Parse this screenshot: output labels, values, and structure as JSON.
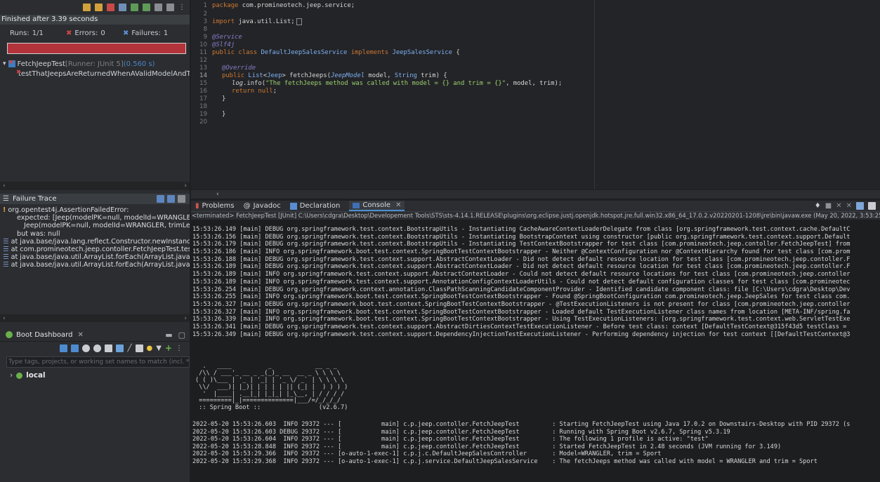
{
  "junit": {
    "status": "Finished after 3.39 seconds",
    "runs_label": "Runs: ",
    "runs_value": "1/1",
    "errors_label": "Errors: ",
    "errors_value": "0",
    "failures_label": "Failures: ",
    "failures_value": "1",
    "progress_color": "#b3333b",
    "tree": [
      {
        "label": "FetchJeepTest",
        "runner": " [Runner: JUnit 5]",
        "time": " (0.560 s)"
      },
      {
        "label": "testThatJeepsAreReturnedWhenAValidModelAndTrimA"
      }
    ]
  },
  "failure_trace": {
    "title": "Failure Trace",
    "lines": [
      "org.opentest4j.AssertionFailedError:",
      "expected: [Jeep(modelPK=null, modelId=WRANGLER, trimLe",
      "Jeep(modelPK=null, modelId=WRANGLER, trimLevel=spor",
      "but was: null",
      "at java.base/java.lang.reflect.Constructor.newInstanceWithC",
      "at com.promineotech.jeep.contoller.FetchJeepTest.testThatJ",
      "at java.base/java.util.ArrayList.forEach(ArrayList.java:1511)",
      "at java.base/java.util.ArrayList.forEach(ArrayList.java:1511)"
    ]
  },
  "boot_dashboard": {
    "tab_label": "Boot Dashboard",
    "filter_placeholder": "Type tags, projects, or working set names to match (incl. * and",
    "item": "local"
  },
  "editor": {
    "lines": [
      {
        "n": "1",
        "text": "package com.promineotech.jeep.service;"
      },
      {
        "n": "2",
        "text": ""
      },
      {
        "n": "3",
        "text": "import java.util.List;"
      },
      {
        "n": "8",
        "text": ""
      },
      {
        "n": "9",
        "text": "@Service"
      },
      {
        "n": "10",
        "text": "@Slf4j"
      },
      {
        "n": "11",
        "text": "public class DefaultJeepSalesService implements JeepSalesService {"
      },
      {
        "n": "12",
        "text": ""
      },
      {
        "n": "13",
        "text": "@Override"
      },
      {
        "n": "14",
        "text": "public List<Jeep> fetchJeeps(JeepModel model, String trim) {"
      },
      {
        "n": "15",
        "text": "log.info(\"The fetchJeeps method was called with model = {} and trim = {}\", model, trim);"
      },
      {
        "n": "16",
        "text": "return null;"
      },
      {
        "n": "17",
        "text": "}"
      },
      {
        "n": "18",
        "text": ""
      },
      {
        "n": "19",
        "text": "}"
      },
      {
        "n": "20",
        "text": ""
      }
    ]
  },
  "console": {
    "tabs": [
      "Problems",
      "Javadoc",
      "Declaration",
      "Console"
    ],
    "terminated": "<terminated> FetchJeepTest [JUnit] C:\\Users\\cdgra\\Desktop\\Developement Tools\\STS\\sts-4.14.1.RELEASE\\plugins\\org.eclipse.justj.openjdk.hotspot.jre.full.win32.x86_64_17.0.2.v20220201-1208\\jre\\bin\\javaw.exe  (May 20, 2022, 3:53:25 PM – 3:5",
    "log": [
      "15:53:26.149 [main] DEBUG org.springframework.test.context.BootstrapUtils - Instantiating CacheAwareContextLoaderDelegate from class [org.springframework.test.context.cache.DefaultC",
      "15:53:26.156 [main] DEBUG org.springframework.test.context.BootstrapUtils - Instantiating BootstrapContext using constructor [public org.springframework.test.context.support.Default",
      "15:53:26.179 [main] DEBUG org.springframework.test.context.BootstrapUtils - Instantiating TestContextBootstrapper for test class [com.promineotech.jeep.contoller.FetchJeepTest] from",
      "15:53:26.186 [main] INFO org.springframework.boot.test.context.SpringBootTestContextBootstrapper - Neither @ContextConfiguration nor @ContextHierarchy found for test class [com.prom",
      "15:53:26.188 [main] DEBUG org.springframework.test.context.support.AbstractContextLoader - Did not detect default resource location for test class [com.promineotech.jeep.contoller.F",
      "15:53:26.189 [main] DEBUG org.springframework.test.context.support.AbstractContextLoader - Did not detect default resource location for test class [com.promineotech.jeep.contoller.F",
      "15:53:26.189 [main] INFO org.springframework.test.context.support.AbstractContextLoader - Could not detect default resource locations for test class [com.promineotech.jeep.contoller",
      "15:53:26.189 [main] INFO org.springframework.test.context.support.AnnotationConfigContextLoaderUtils - Could not detect default configuration classes for test class [com.promineotec",
      "15:53:26.254 [main] DEBUG org.springframework.context.annotation.ClassPathScanningCandidateComponentProvider - Identified candidate component class: file [C:\\Users\\cdgra\\Desktop\\Dev",
      "15:53:26.255 [main] INFO org.springframework.boot.test.context.SpringBootTestContextBootstrapper - Found @SpringBootConfiguration com.promineotech.jeep.JeepSales for test class com.",
      "15:53:26.327 [main] DEBUG org.springframework.boot.test.context.SpringBootTestContextBootstrapper - @TestExecutionListeners is not present for class [com.promineotech.jeep.contoller",
      "15:53:26.327 [main] INFO org.springframework.boot.test.context.SpringBootTestContextBootstrapper - Loaded default TestExecutionListener class names from location [META-INF/spring.fa",
      "15:53:26.339 [main] INFO org.springframework.boot.test.context.SpringBootTestContextBootstrapper - Using TestExecutionListeners: [org.springframework.test.context.web.ServletTestExe",
      "15:53:26.341 [main] DEBUG org.springframework.test.context.support.AbstractDirtiesContextTestExecutionListener - Before test class: context [DefaultTestContext@315f43d5 testClass = ",
      "15:53:26.349 [main] DEBUG org.springframework.test.context.support.DependencyInjectionTestExecutionListener - Performing dependency injection for test context [[DefaultTestContext@3"
    ],
    "banner": [
      "  .   ____          _            __ _ _",
      " /\\\\ / ___'_ __ _ _(_)_ __  __ _ \\ \\ \\ \\",
      "( ( )\\___ | '_ | '_| | '_ \\/ _` | \\ \\ \\ \\",
      " \\\\/  ___)| |_)| | | | | || (_| |  ) ) ) )",
      "  '  |____| .__|_| |_|_| |_\\__, | / / / /",
      " =========|_|==============|___/=/_/_/_/",
      " :: Spring Boot ::                (v2.6.7)"
    ],
    "boot_log": [
      "2022-05-20 15:53:26.603  INFO 29372 --- [           main] c.p.jeep.contoller.FetchJeepTest         : Starting FetchJeepTest using Java 17.0.2 on Downstairs-Desktop with PID 29372 (s",
      "2022-05-20 15:53:26.603 DEBUG 29372 --- [           main] c.p.jeep.contoller.FetchJeepTest         : Running with Spring Boot v2.6.7, Spring v5.3.19",
      "2022-05-20 15:53:26.604  INFO 29372 --- [           main] c.p.jeep.contoller.FetchJeepTest         : The following 1 profile is active: \"test\"",
      "2022-05-20 15:53:28.848  INFO 29372 --- [           main] c.p.jeep.contoller.FetchJeepTest         : Started FetchJeepTest in 2.48 seconds (JVM running for 3.149)",
      "2022-05-20 15:53:29.366  INFO 29372 --- [o-auto-1-exec-1] c.p.j.c.DefaultJeepSalesController       : Model=WRANGLER, trim = Sport",
      "2022-05-20 15:53:29.368  INFO 29372 --- [o-auto-1-exec-1] c.p.j.service.DefaultJeepSalesService    : The fetchJeeps method was called with model = WRANGLER and trim = Sport"
    ]
  }
}
